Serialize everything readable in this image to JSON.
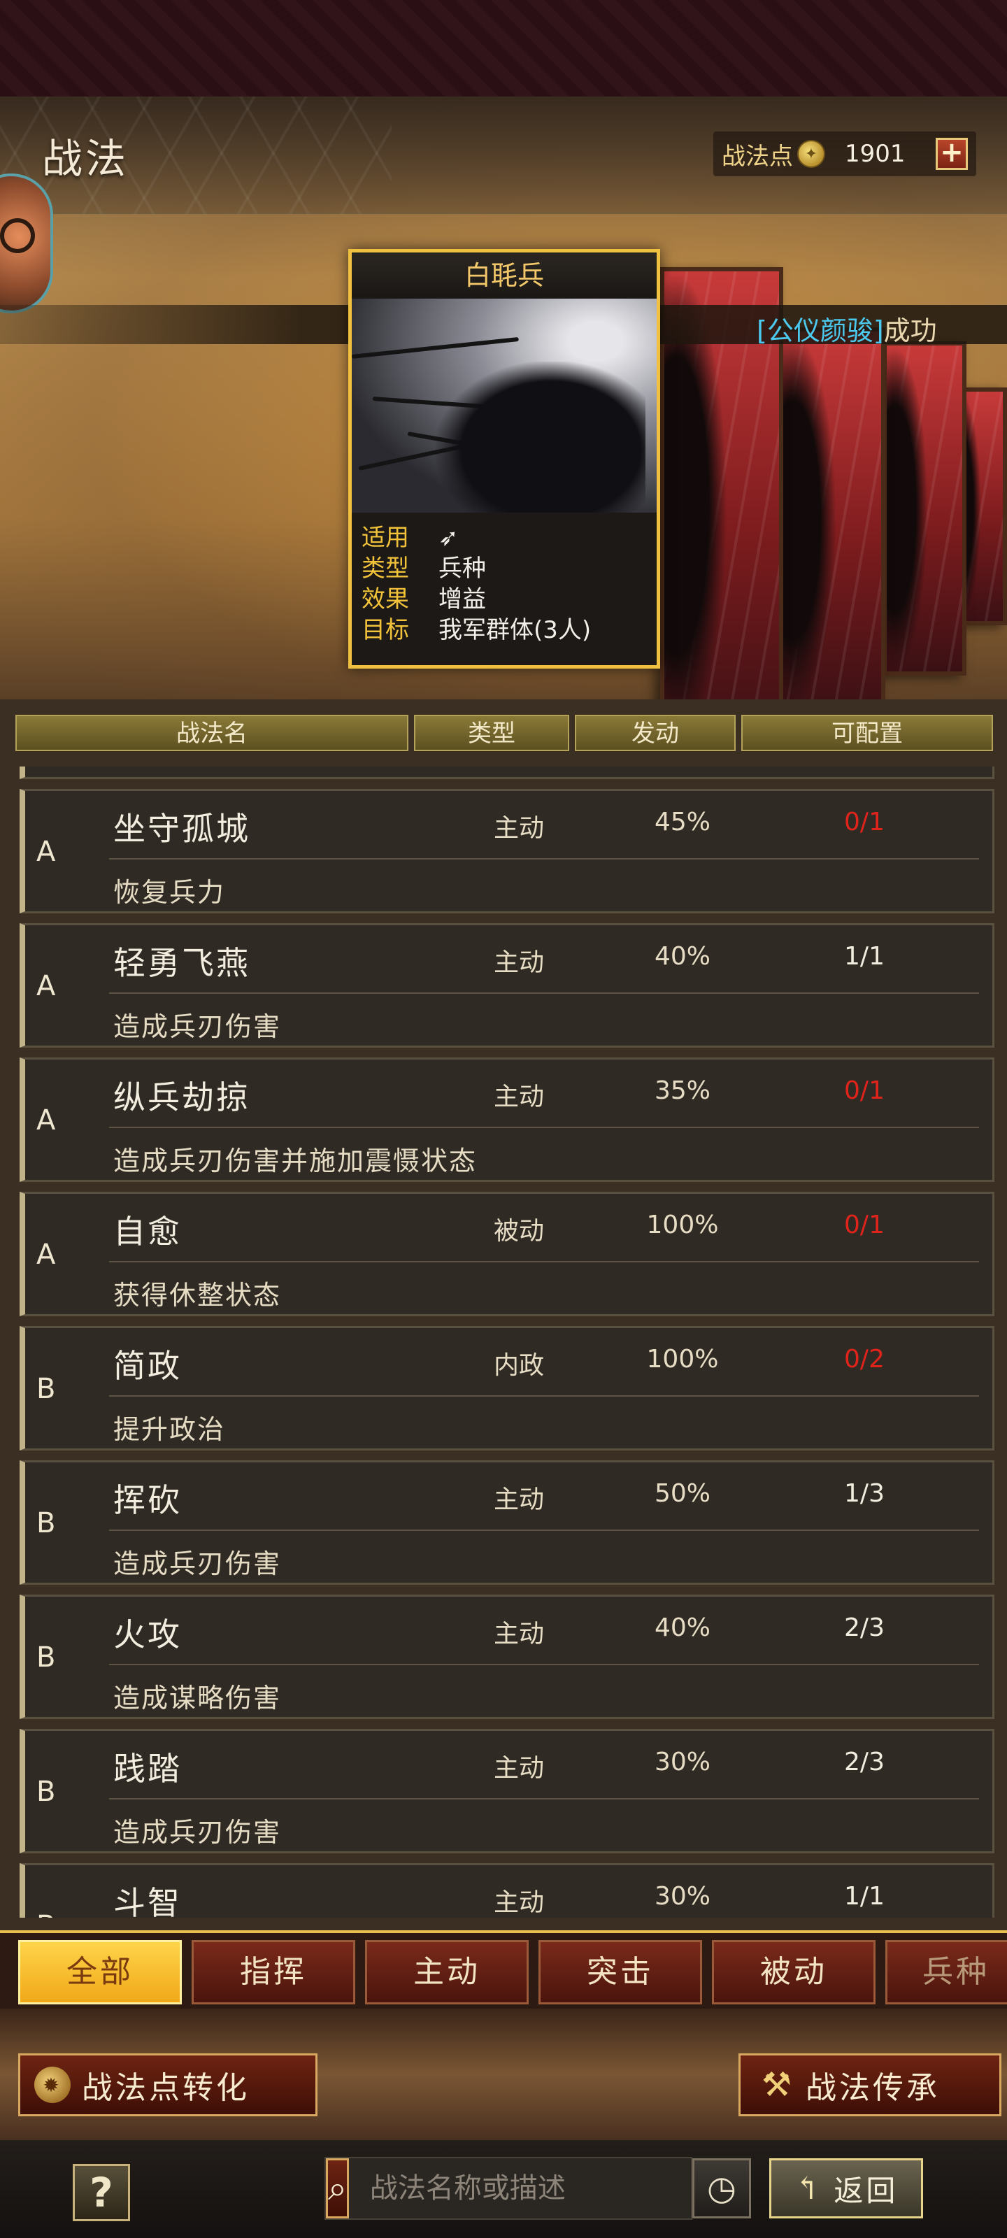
{
  "header": {
    "title": "战法",
    "points_label": "战法点",
    "points_value": "1901",
    "plus_label": "+"
  },
  "marquee": {
    "name": "[公仪颜骏]",
    "text": "成功"
  },
  "featured": {
    "name": "白毦兵",
    "stats": [
      {
        "key": "适用",
        "value": ""
      },
      {
        "key": "类型",
        "value": "兵种"
      },
      {
        "key": "效果",
        "value": "增益"
      },
      {
        "key": "目标",
        "value": "我军群体(3人)"
      }
    ]
  },
  "columns": [
    "战法名",
    "类型",
    "发动",
    "可配置"
  ],
  "rows": [
    {
      "grade": "A",
      "name": "坐守孤城",
      "type": "主动",
      "rate": "45%",
      "config": "0/1",
      "desc": "恢复兵力",
      "config_color": "#e0241c"
    },
    {
      "grade": "A",
      "name": "轻勇飞燕",
      "type": "主动",
      "rate": "40%",
      "config": "1/1",
      "desc": "造成兵刃伤害",
      "config_color": "#f3ede0"
    },
    {
      "grade": "A",
      "name": "纵兵劫掠",
      "type": "主动",
      "rate": "35%",
      "config": "0/1",
      "desc": "造成兵刃伤害并施加震慑状态",
      "config_color": "#e0241c"
    },
    {
      "grade": "A",
      "name": "自愈",
      "type": "被动",
      "rate": "100%",
      "config": "0/1",
      "desc": "获得休整状态",
      "config_color": "#e0241c"
    },
    {
      "grade": "B",
      "name": "简政",
      "type": "内政",
      "rate": "100%",
      "config": "0/2",
      "desc": "提升政治",
      "config_color": "#e0241c"
    },
    {
      "grade": "B",
      "name": "挥砍",
      "type": "主动",
      "rate": "50%",
      "config": "1/3",
      "desc": "造成兵刃伤害",
      "config_color": "#f3ede0"
    },
    {
      "grade": "B",
      "name": "火攻",
      "type": "主动",
      "rate": "40%",
      "config": "2/3",
      "desc": "造成谋略伤害",
      "config_color": "#f3ede0"
    },
    {
      "grade": "B",
      "name": "践踏",
      "type": "主动",
      "rate": "30%",
      "config": "2/3",
      "desc": "造成兵刃伤害",
      "config_color": "#f3ede0"
    },
    {
      "grade": "B",
      "name": "斗智",
      "type": "主动",
      "rate": "30%",
      "config": "1/1",
      "desc": "",
      "config_color": "#f3ede0"
    }
  ],
  "tabs": [
    "全部",
    "指挥",
    "主动",
    "突击",
    "被动",
    "兵种"
  ],
  "actions": {
    "convert_label": "战法点转化",
    "inherit_label": "战法传承"
  },
  "bottom": {
    "help_label": "?",
    "search_placeholder": "战法名称或描述",
    "back_label": "返回"
  },
  "colors": {
    "accent_gold": "#f0c040",
    "alert_red": "#e0241c",
    "marquee_cyan": "#4cc9ee"
  }
}
